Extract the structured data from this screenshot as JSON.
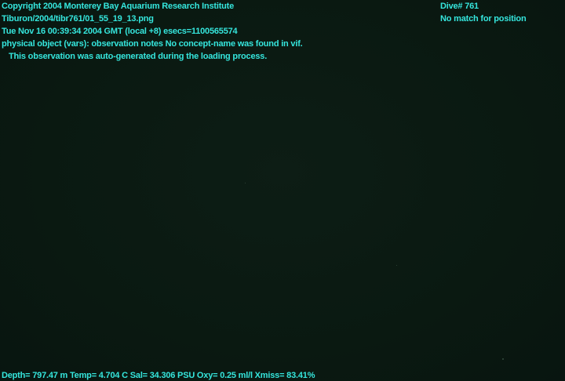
{
  "overlay": {
    "copyright": "Copyright 2004 Monterey Bay Aquarium Research Institute",
    "file_path": "Tiburon/2004/tibr761/01_55_19_13.png",
    "timestamp": "Tue Nov 16 00:39:34 2004 GMT (local +8)  esecs=1100565574",
    "observation": "physical object (vars): observation notes No concept-name was found in vif.",
    "observation_note": "This observation was auto-generated during the loading process.",
    "dive": "Dive# 761",
    "position_status": "No match for position",
    "sensor_line": "Depth= 797.47 m  Temp= 4.704 C  Sal= 34.306 PSU  Oxy= 0.25 ml/l  Xmiss= 83.41%"
  },
  "colors": {
    "overlay_text": "#35e6dd",
    "background": "#0b1a12"
  }
}
